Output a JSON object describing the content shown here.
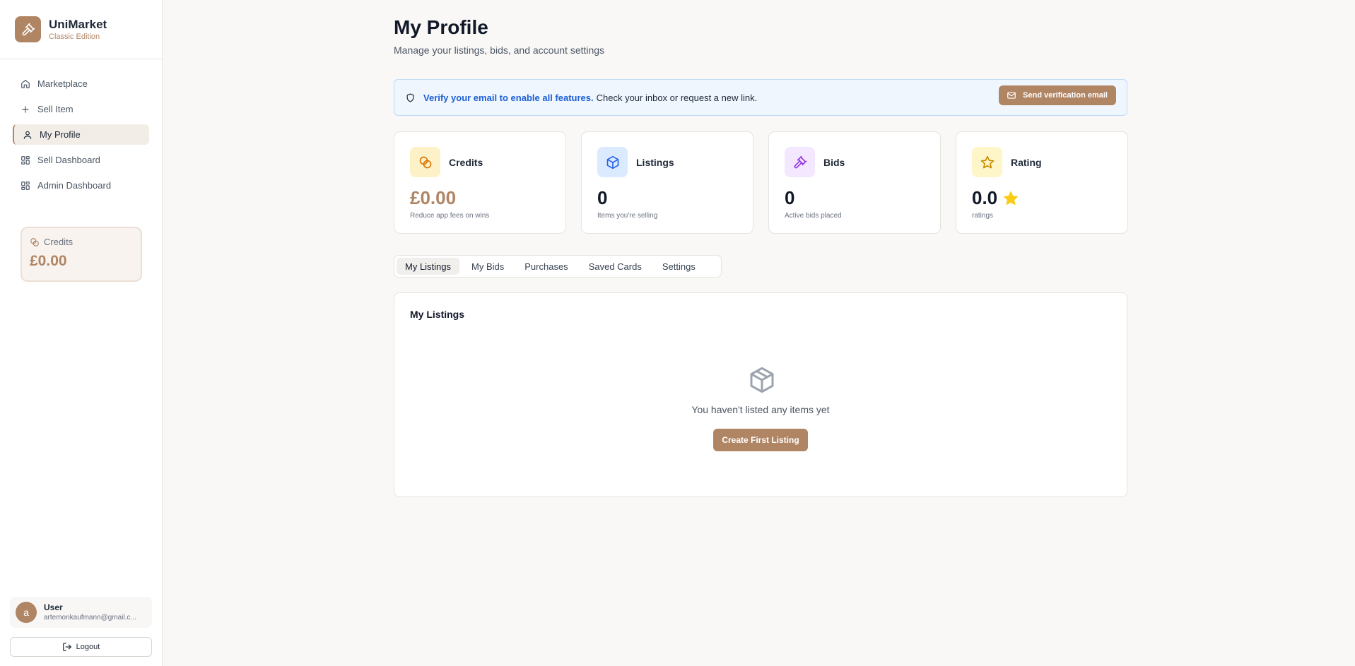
{
  "brand": {
    "name": "UniMarket",
    "subtitle": "Classic Edition",
    "accent_color": "#b08564"
  },
  "sidebar": {
    "items": [
      {
        "label": "Marketplace",
        "icon": "home-icon",
        "active": false
      },
      {
        "label": "Sell Item",
        "icon": "plus-icon",
        "active": false
      },
      {
        "label": "My Profile",
        "icon": "user-icon",
        "active": true
      },
      {
        "label": "Sell Dashboard",
        "icon": "grid-icon",
        "active": false
      },
      {
        "label": "Admin Dashboard",
        "icon": "grid-icon",
        "active": false
      }
    ],
    "credits": {
      "label": "Credits",
      "amount": "£0.00",
      "icon": "coins-icon"
    }
  },
  "user": {
    "avatar_initial": "a",
    "name": "User",
    "email": "artemonkaufmann@gmail.c...",
    "logout_label": "Logout"
  },
  "page": {
    "title": "My Profile",
    "subtitle": "Manage your listings, bids, and account settings"
  },
  "verify": {
    "strong": "Verify your email to enable all features.",
    "text": "Check your inbox or request a new link.",
    "button_label": "Send verification email",
    "icon": "shield-icon"
  },
  "stats": [
    {
      "label": "Credits",
      "value": "£0.00",
      "desc": "Reduce app fees on wins",
      "icon": "coins-icon",
      "icon_bg": "#fdf1c8",
      "icon_color": "#d97706"
    },
    {
      "label": "Listings",
      "value": "0",
      "desc": "Items you're selling",
      "icon": "box-icon",
      "icon_bg": "#dbeafe",
      "icon_color": "#2563eb"
    },
    {
      "label": "Bids",
      "value": "0",
      "desc": "Active bids placed",
      "icon": "gavel-icon",
      "icon_bg": "#f3e8ff",
      "icon_color": "#9333ea"
    },
    {
      "label": "Rating",
      "value": "0.0",
      "desc": "ratings",
      "icon": "star-icon",
      "icon_bg": "#fef6c8",
      "icon_color": "#ca8a04"
    }
  ],
  "tabs": [
    {
      "label": "My Listings",
      "active": true
    },
    {
      "label": "My Bids",
      "active": false
    },
    {
      "label": "Purchases",
      "active": false
    },
    {
      "label": "Saved Cards",
      "active": false
    },
    {
      "label": "Settings",
      "active": false
    }
  ],
  "listings_panel": {
    "title": "My Listings",
    "empty_text": "You haven't listed any items yet",
    "create_label": "Create First Listing"
  }
}
